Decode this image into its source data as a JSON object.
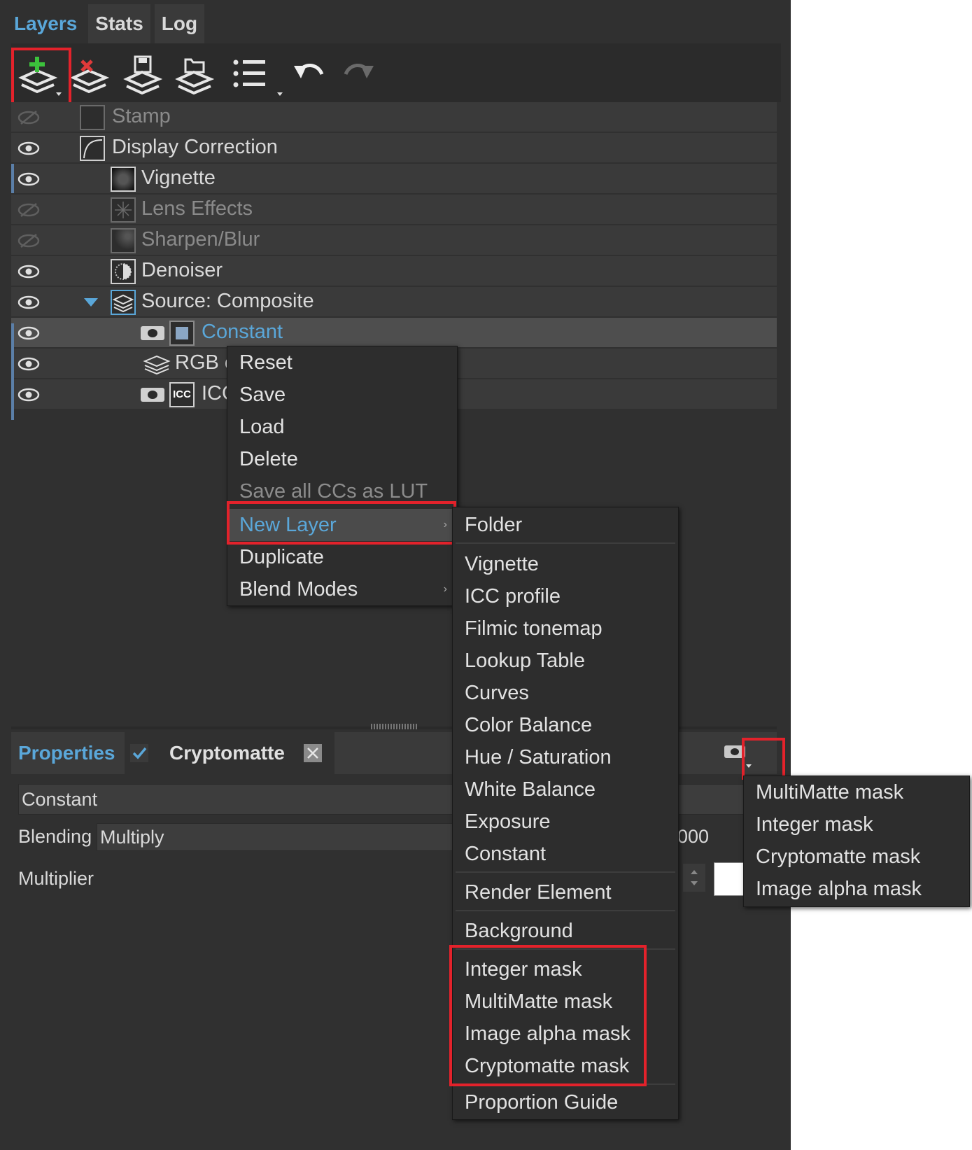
{
  "tabs": [
    {
      "label": "Layers",
      "active": true
    },
    {
      "label": "Stats",
      "active": false
    },
    {
      "label": "Log",
      "active": false
    }
  ],
  "toolbar": {
    "icons": [
      "add-layer-icon",
      "delete-layer-icon",
      "save-layer-icon",
      "load-layer-icon",
      "list-menu-icon",
      "undo-icon",
      "redo-icon"
    ]
  },
  "layers": [
    {
      "label": "Stamp",
      "visible": false
    },
    {
      "label": "Display Correction",
      "visible": true
    },
    {
      "label": "Vignette",
      "visible": true
    },
    {
      "label": "Lens Effects",
      "visible": false
    },
    {
      "label": "Sharpen/Blur",
      "visible": false
    },
    {
      "label": "Denoiser",
      "visible": true
    },
    {
      "label": "Source: Composite",
      "visible": true,
      "expanded": true
    },
    {
      "label": "Constant",
      "visible": true,
      "selected": true
    },
    {
      "label": "RGB c",
      "visible": true
    },
    {
      "label": "ICC",
      "visible": true
    }
  ],
  "icc_badge": "ICC",
  "context_menu": {
    "items": [
      "Reset",
      "Save",
      "Load",
      "Delete",
      "Save all CCs as LUT",
      "New Layer",
      "Duplicate",
      "Blend Modes"
    ],
    "disabled": [
      "Save all CCs as LUT"
    ],
    "highlighted": "New Layer"
  },
  "new_layer_menu": {
    "group1": [
      "Folder"
    ],
    "group2": [
      "Vignette",
      "ICC profile",
      "Filmic tonemap",
      "Lookup Table",
      "Curves",
      "Color Balance",
      "Hue / Saturation",
      "White Balance",
      "Exposure",
      "Constant"
    ],
    "group3": [
      "Render Element"
    ],
    "group4": [
      "Background"
    ],
    "group5": [
      "Integer mask",
      "MultiMatte mask",
      "Image alpha mask",
      "Cryptomatte mask"
    ],
    "group6": [
      "Proportion Guide"
    ]
  },
  "mask_menu": {
    "items": [
      "MultiMatte mask",
      "Integer mask",
      "Cryptomatte mask",
      "Image alpha mask"
    ]
  },
  "properties": {
    "title": "Properties",
    "tab2": "Cryptomatte",
    "name_value": "Constant",
    "blending_label": "Blending",
    "blending_value": "Multiply",
    "multiplier_label": "Multiplier",
    "multiplier_value_partial": "000"
  },
  "colors": {
    "accent": "#5aa7d9",
    "highlight": "#e3222b",
    "panel": "#303030"
  }
}
